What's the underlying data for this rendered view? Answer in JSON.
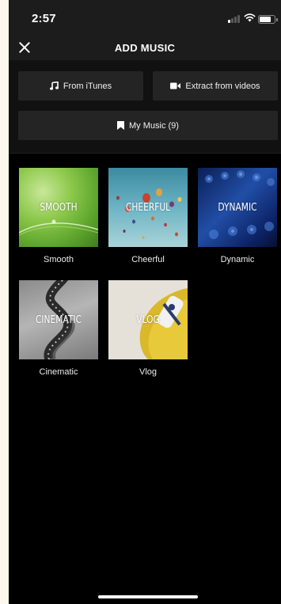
{
  "status_bar": {
    "time": "2:57"
  },
  "header": {
    "title": "ADD MUSIC"
  },
  "sources": {
    "itunes_label": "From iTunes",
    "extract_label": "Extract from videos",
    "my_music_label": "My Music (9)"
  },
  "moods": [
    {
      "thumb_label": "SMOOTH",
      "caption": "Smooth"
    },
    {
      "thumb_label": "CHEERFUL",
      "caption": "Cheerful"
    },
    {
      "thumb_label": "DYNAMIC",
      "caption": "Dynamic"
    },
    {
      "thumb_label": "CINEMATIC",
      "caption": "Cinematic"
    },
    {
      "thumb_label": "VLOG",
      "caption": "Vlog"
    }
  ],
  "icons": {
    "close": "close-icon",
    "music_note": "music-note-icon",
    "video_camera": "video-camera-icon",
    "bookmark": "bookmark-icon",
    "signal": "signal-icon",
    "wifi": "wifi-icon",
    "battery": "battery-icon"
  },
  "colors": {
    "background": "#000000",
    "bar": "#1c1c1c",
    "button": "#242424",
    "text": "#ffffff"
  }
}
